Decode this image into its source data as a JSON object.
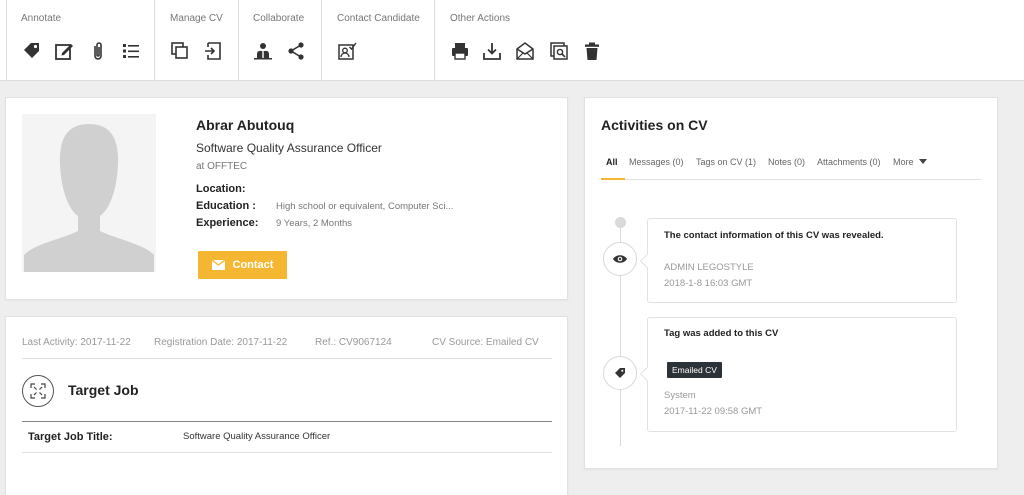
{
  "toolbar": {
    "groups": [
      {
        "title": "Annotate",
        "icons": [
          "tag-icon",
          "edit-icon",
          "attachment-icon",
          "list-icon"
        ]
      },
      {
        "title": "Manage CV",
        "icons": [
          "copy-icon",
          "import-icon"
        ]
      },
      {
        "title": "Collaborate",
        "icons": [
          "team-icon",
          "share-icon"
        ]
      },
      {
        "title": "Contact Candidate",
        "icons": [
          "contact-card-icon"
        ]
      },
      {
        "title": "Other Actions",
        "icons": [
          "print-icon",
          "download-icon",
          "email-icon",
          "preview-icon",
          "delete-icon"
        ]
      }
    ]
  },
  "profile": {
    "name": "Abrar Abutouq",
    "title": "Software Quality Assurance Officer",
    "company": "at OFFTEC",
    "location_label": "Location:",
    "location_value": "",
    "education_label": "Education :",
    "education_value": "High school or equivalent, Computer Sci...",
    "experience_label": "Experience:",
    "experience_value": "9 Years, 2 Months",
    "contact_button": "Contact"
  },
  "meta": {
    "last_activity": "Last Activity: 2017-11-22",
    "registration_date": "Registration Date: 2017-11-22",
    "ref": "Ref.: CV9067124",
    "source": "CV Source: Emailed CV"
  },
  "target_job": {
    "heading": "Target Job",
    "title_label": "Target Job Title:",
    "title_value": "Software Quality Assurance Officer"
  },
  "activities": {
    "heading": "Activities on CV",
    "tabs": [
      "All",
      "Messages (0)",
      "Tags on CV (1)",
      "Notes (0)",
      "Attachments (0)",
      "More"
    ],
    "items": [
      {
        "text": "The contact information of this CV was revealed.",
        "user": "ADMIN LEGOSTYLE",
        "time": "2018-1-8 16:03 GMT",
        "icon": "eye-icon"
      },
      {
        "text": "Tag was added to this CV",
        "tag": "Emailed CV",
        "user": "System",
        "time": "2017-11-22 09:58 GMT",
        "icon": "tag-icon"
      }
    ]
  },
  "colors": {
    "accent": "#f5b731",
    "badge": "#2b3238"
  }
}
